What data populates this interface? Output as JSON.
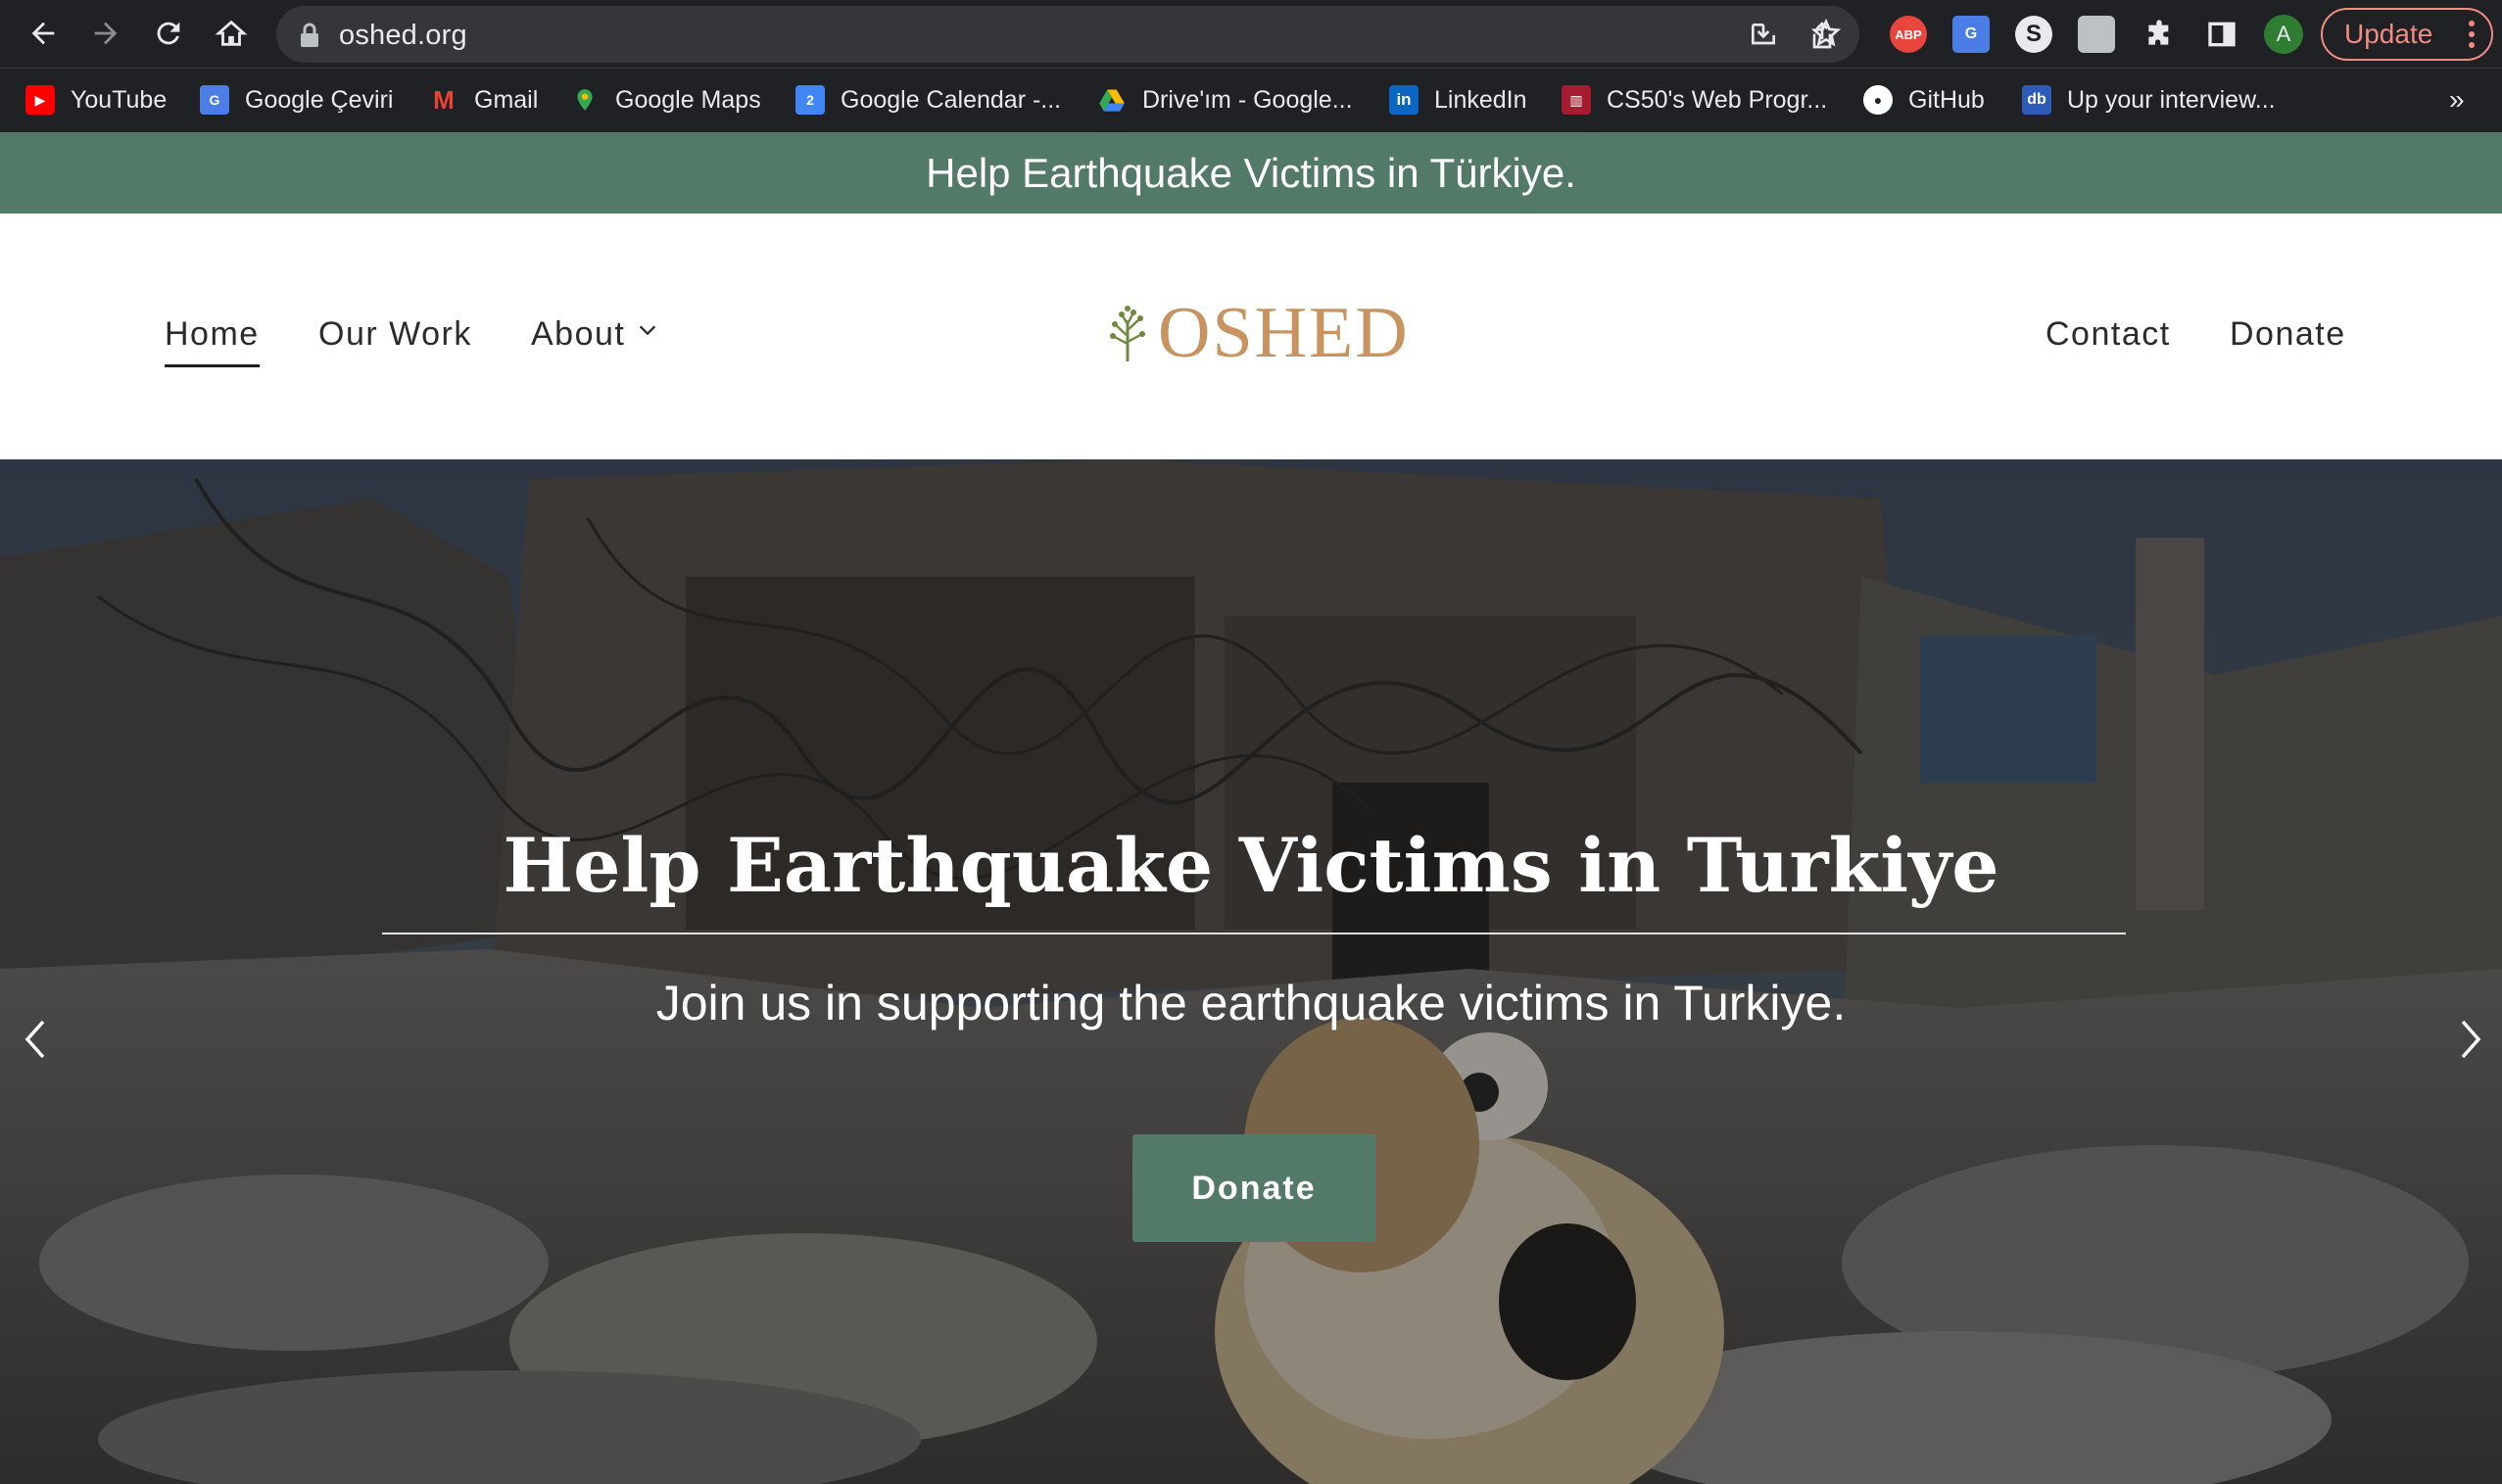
{
  "browser": {
    "url": "oshed.org",
    "update_label": "Update",
    "profile_initial": "A",
    "bookmarks": [
      {
        "label": "YouTube",
        "icon": "youtube-icon",
        "color": "#ff0000"
      },
      {
        "label": "Google Çeviri",
        "icon": "google-translate-icon",
        "color": "#4a7ee6"
      },
      {
        "label": "Gmail",
        "icon": "gmail-icon",
        "color": "#ea4335"
      },
      {
        "label": "Google Maps",
        "icon": "google-maps-icon",
        "color": "#34a853"
      },
      {
        "label": "Google Calendar -...",
        "icon": "google-calendar-icon",
        "color": "#4285f4"
      },
      {
        "label": "Drive'ım - Google...",
        "icon": "google-drive-icon",
        "color": "#fbbc04"
      },
      {
        "label": "LinkedIn",
        "icon": "linkedin-icon",
        "color": "#0a66c2"
      },
      {
        "label": "CS50's Web Progr...",
        "icon": "harvard-icon",
        "color": "#a51c30"
      },
      {
        "label": "GitHub",
        "icon": "github-icon",
        "color": "#ffffff"
      },
      {
        "label": "Up your interview...",
        "icon": "db-icon",
        "color": "#2d5bb8"
      }
    ],
    "bookmarks_more": "»"
  },
  "announcement": "Help Earthquake Victims in Türkiye.",
  "header": {
    "nav_left": [
      {
        "label": "Home",
        "active": true
      },
      {
        "label": "Our Work"
      },
      {
        "label": "About"
      }
    ],
    "logo_text": "OSHED",
    "nav_right": [
      {
        "label": "Contact"
      },
      {
        "label": "Donate"
      }
    ]
  },
  "hero": {
    "title": "Help Earthquake Victims in Turkiye",
    "subtitle": "Join us in supporting the earthquake victims in Turkiye.",
    "button_label": "Donate",
    "background": "earthquake-rubble-photo"
  },
  "colors": {
    "brand_green": "#537a68",
    "logo_gold": "#c8935f",
    "chrome_bg": "#202124"
  }
}
